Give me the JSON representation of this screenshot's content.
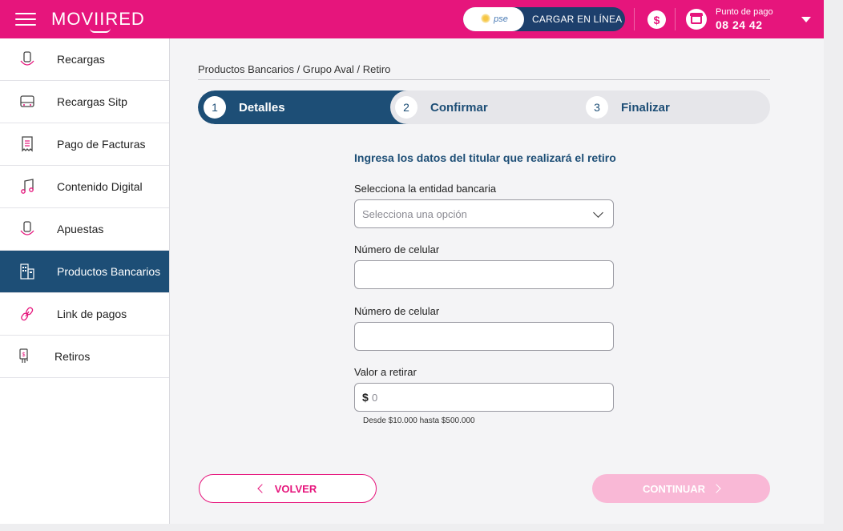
{
  "header": {
    "brand": "MOVIIRED",
    "pse_badge": "pse",
    "load_online": "CARGAR EN LÍNEA",
    "dollar_symbol": "$",
    "point_label": "Punto de pago",
    "point_value": "08 24 42",
    "colors": {
      "brand_pink": "#e6157c",
      "navy": "#1d4e76"
    }
  },
  "sidebar": {
    "items": [
      {
        "label": "Recargas",
        "icon": "phone-recharge-icon"
      },
      {
        "label": "Recargas Sitp",
        "icon": "bus-icon"
      },
      {
        "label": "Pago de Facturas",
        "icon": "receipt-icon"
      },
      {
        "label": "Contenido Digital",
        "icon": "music-note-icon"
      },
      {
        "label": "Apuestas",
        "icon": "phone-recharge-icon"
      },
      {
        "label": "Productos Bancarios",
        "icon": "buildings-icon",
        "active": true
      },
      {
        "label": "Link de pagos",
        "icon": "link-icon"
      },
      {
        "label": "Retiros",
        "icon": "withdraw-icon"
      }
    ]
  },
  "main": {
    "breadcrumb": "Productos Bancarios / Grupo Aval / Retiro",
    "steps": [
      {
        "num": "1",
        "label": "Detalles"
      },
      {
        "num": "2",
        "label": "Confirmar"
      },
      {
        "num": "3",
        "label": "Finalizar"
      }
    ],
    "form": {
      "title": "Ingresa los datos del titular que realizará el retiro",
      "bank_label": "Selecciona la entidad bancaria",
      "bank_placeholder": "Selecciona una opción",
      "phone_label": "Número de celular",
      "phone_confirm_label": "Número de celular",
      "amount_label": "Valor a retirar",
      "currency": "$",
      "amount_placeholder": "0",
      "amount_hint": "Desde $10.000 hasta $500.000"
    },
    "back_label": "VOLVER",
    "next_label": "CONTINUAR"
  }
}
